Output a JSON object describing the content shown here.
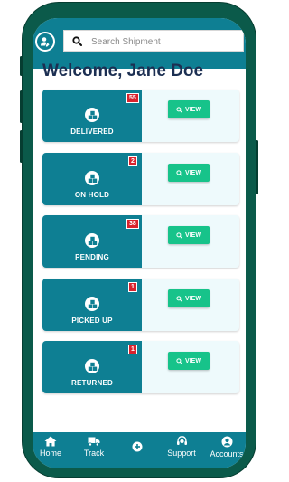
{
  "search": {
    "placeholder": "Search Shipment"
  },
  "welcome": "Welcome, Jane Doe",
  "cards": [
    {
      "label": "DELIVERED",
      "count": "55",
      "view_label": "VIEW"
    },
    {
      "label": "ON HOLD",
      "count": "2",
      "view_label": "VIEW"
    },
    {
      "label": "PENDING",
      "count": "38",
      "view_label": "VIEW"
    },
    {
      "label": "PICKED UP",
      "count": "1",
      "view_label": "VIEW"
    },
    {
      "label": "RETURNED",
      "count": "1",
      "view_label": "VIEW"
    }
  ],
  "nav": {
    "home": "Home",
    "track": "Track",
    "support": "Support",
    "accounts": "Accounts"
  },
  "colors": {
    "primary": "#0e7f93",
    "phone_frame": "#0b5a4a",
    "button": "#17c38a",
    "badge": "#d9232d",
    "heading": "#1c2f52"
  },
  "icons": {
    "avatar": "user-edit-icon",
    "search": "search-icon",
    "card": "boxes-icon",
    "view": "magnifier-icon",
    "home": "home-icon",
    "track": "truck-icon",
    "add": "plus-circle-icon",
    "support": "headset-icon",
    "accounts": "user-circle-icon"
  }
}
